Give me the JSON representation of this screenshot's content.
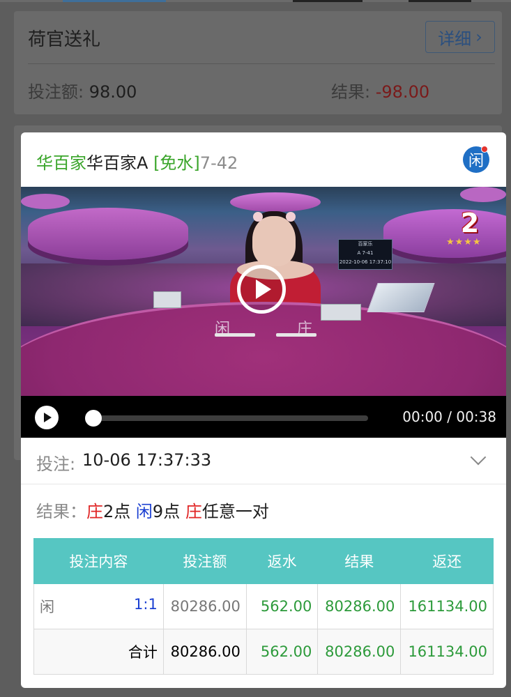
{
  "background": {
    "card_title": "荷官送礼",
    "detail_button": "详细",
    "bet_amount_label": "投注额:",
    "bet_amount_value": "98.00",
    "result_label": "结果:",
    "result_value": "-98.00"
  },
  "modal": {
    "title_game": "华百家A",
    "title_tag": "[免水]",
    "title_round": "7-42",
    "badge_icon": "闲",
    "video": {
      "player_label": "闲",
      "banker_label": "庄",
      "screen_line1": "百家乐",
      "screen_line2": "A  7-41",
      "screen_line3": "2022-10-06 17:37:10",
      "badge_number": "2",
      "time": "00:00 / 00:38",
      "progress": 0.0
    },
    "bet": {
      "label": "投注:",
      "value": "10-06 17:37:33"
    },
    "result": {
      "label": "结果：",
      "banker_tag": "庄",
      "banker_points": "2点",
      "player_tag": "闲",
      "player_points": "9点",
      "pair_tag": "庄",
      "pair_text": "任意一对"
    },
    "table": {
      "headers": [
        "投注内容",
        "投注额",
        "返水",
        "结果",
        "返还"
      ],
      "row": {
        "bet_type": "闲",
        "odds": "1:1",
        "amount": "80286.00",
        "rebate": "562.00",
        "result": "80286.00",
        "return": "161134.00"
      },
      "total": {
        "label": "合计",
        "amount": "80286.00",
        "rebate": "562.00",
        "result": "80286.00",
        "return": "161134.00"
      }
    }
  },
  "colors": {
    "accent_teal": "#56c6c2",
    "green": "#2c9a3a",
    "red": "#e02424",
    "blue": "#1a3fd2"
  }
}
